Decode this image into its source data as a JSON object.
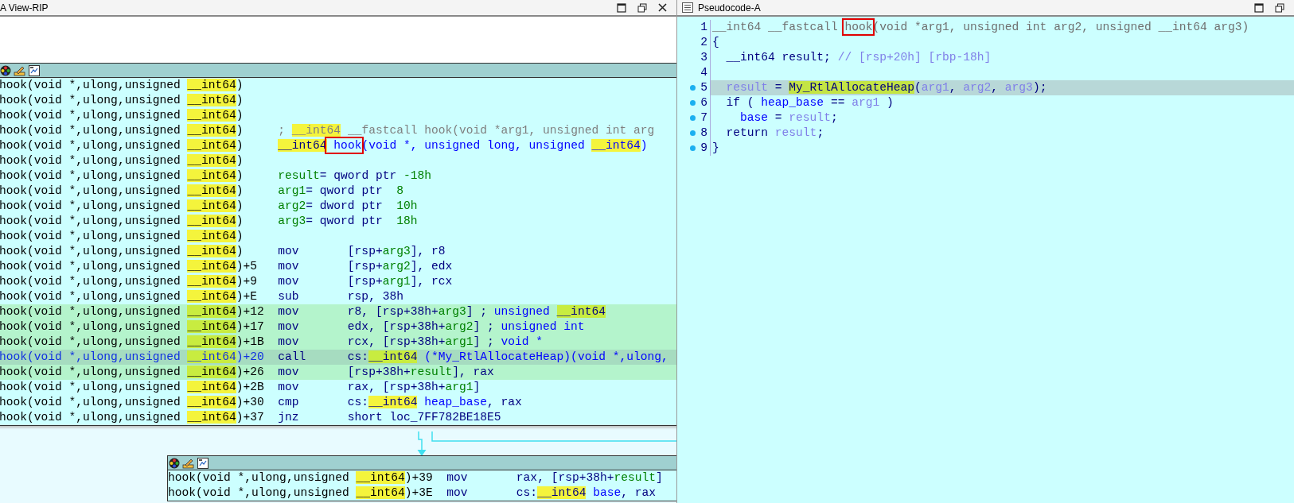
{
  "disassembly": {
    "title": "A View-RIP",
    "node": {
      "rows": [
        {
          "traced": false,
          "selected": false,
          "location": [
            {
              "text": "hook(void *,ulong,unsigned "
            },
            {
              "text": "__int64",
              "kind": "type"
            },
            {
              "text": ")"
            }
          ]
        },
        {
          "traced": false,
          "selected": false,
          "location": [
            {
              "text": "hook(void *,ulong,unsigned "
            },
            {
              "text": "__int64",
              "kind": "type"
            },
            {
              "text": ")"
            }
          ]
        },
        {
          "traced": false,
          "selected": false,
          "location": [
            {
              "text": "hook(void *,ulong,unsigned "
            },
            {
              "text": "__int64",
              "kind": "type"
            },
            {
              "text": ")"
            }
          ]
        },
        {
          "traced": false,
          "selected": false,
          "location": [
            {
              "text": "hook(void *,ulong,unsigned "
            },
            {
              "text": "__int64",
              "kind": "type"
            },
            {
              "text": ")"
            }
          ],
          "operands": [
            {
              "text": "; ",
              "kind": "comment"
            },
            {
              "text": "__int64",
              "kind": "type-comment"
            },
            {
              "text": " __fastcall hook(void *arg1, unsigned int arg",
              "kind": "comment"
            }
          ]
        },
        {
          "traced": false,
          "selected": false,
          "location": [
            {
              "text": "hook(void *,ulong,unsigned "
            },
            {
              "text": "__int64",
              "kind": "type"
            },
            {
              "text": ")"
            }
          ],
          "operands": [
            {
              "text": "__int64",
              "kind": "type"
            },
            {
              "text": " hook",
              "kind": "name",
              "marked": true
            },
            {
              "text": "(void *, unsigned long, unsigned ",
              "kind": "name"
            },
            {
              "text": "__int64",
              "kind": "type-name"
            },
            {
              "text": ")",
              "kind": "name"
            }
          ]
        },
        {
          "traced": false,
          "selected": false,
          "location": [
            {
              "text": "hook(void *,ulong,unsigned "
            },
            {
              "text": "__int64",
              "kind": "type"
            },
            {
              "text": ")"
            }
          ]
        },
        {
          "traced": false,
          "selected": false,
          "location": [
            {
              "text": "hook(void *,ulong,unsigned "
            },
            {
              "text": "__int64",
              "kind": "type"
            },
            {
              "text": ")"
            }
          ],
          "operands": [
            {
              "text": "result",
              "kind": "var"
            },
            {
              "text": "= qword ptr "
            },
            {
              "text": "-18h",
              "kind": "var"
            }
          ]
        },
        {
          "traced": false,
          "selected": false,
          "location": [
            {
              "text": "hook(void *,ulong,unsigned "
            },
            {
              "text": "__int64",
              "kind": "type"
            },
            {
              "text": ")"
            }
          ],
          "operands": [
            {
              "text": "arg1",
              "kind": "var"
            },
            {
              "text": "= qword ptr  "
            },
            {
              "text": "8",
              "kind": "var"
            }
          ]
        },
        {
          "traced": false,
          "selected": false,
          "location": [
            {
              "text": "hook(void *,ulong,unsigned "
            },
            {
              "text": "__int64",
              "kind": "type"
            },
            {
              "text": ")"
            }
          ],
          "operands": [
            {
              "text": "arg2",
              "kind": "var"
            },
            {
              "text": "= dword ptr  "
            },
            {
              "text": "10h",
              "kind": "var"
            }
          ]
        },
        {
          "traced": false,
          "selected": false,
          "location": [
            {
              "text": "hook(void *,ulong,unsigned "
            },
            {
              "text": "__int64",
              "kind": "type"
            },
            {
              "text": ")"
            }
          ],
          "operands": [
            {
              "text": "arg3",
              "kind": "var"
            },
            {
              "text": "= qword ptr  "
            },
            {
              "text": "18h",
              "kind": "var"
            }
          ]
        },
        {
          "traced": false,
          "selected": false,
          "location": [
            {
              "text": "hook(void *,ulong,unsigned "
            },
            {
              "text": "__int64",
              "kind": "type"
            },
            {
              "text": ")"
            }
          ]
        },
        {
          "traced": false,
          "selected": false,
          "location": [
            {
              "text": "hook(void *,ulong,unsigned "
            },
            {
              "text": "__int64",
              "kind": "type"
            },
            {
              "text": ")"
            }
          ],
          "mnemonic": "mov",
          "operands": [
            {
              "text": "[rsp+"
            },
            {
              "text": "arg3",
              "kind": "var"
            },
            {
              "text": "], r8"
            }
          ]
        },
        {
          "traced": false,
          "selected": false,
          "location": [
            {
              "text": "hook(void *,ulong,unsigned "
            },
            {
              "text": "__int64",
              "kind": "type"
            },
            {
              "text": ")+5"
            }
          ],
          "mnemonic": "mov",
          "operands": [
            {
              "text": "[rsp+"
            },
            {
              "text": "arg2",
              "kind": "var"
            },
            {
              "text": "], edx"
            }
          ]
        },
        {
          "traced": false,
          "selected": false,
          "location": [
            {
              "text": "hook(void *,ulong,unsigned "
            },
            {
              "text": "__int64",
              "kind": "type"
            },
            {
              "text": ")+9"
            }
          ],
          "mnemonic": "mov",
          "operands": [
            {
              "text": "[rsp+"
            },
            {
              "text": "arg1",
              "kind": "var"
            },
            {
              "text": "], rcx"
            }
          ]
        },
        {
          "traced": false,
          "selected": false,
          "location": [
            {
              "text": "hook(void *,ulong,unsigned "
            },
            {
              "text": "__int64",
              "kind": "type"
            },
            {
              "text": ")+E"
            }
          ],
          "mnemonic": "sub",
          "operands": [
            {
              "text": "rsp, 38h"
            }
          ]
        },
        {
          "traced": true,
          "selected": false,
          "location": [
            {
              "text": "hook(void *,ulong,unsigned "
            },
            {
              "text": "__int64",
              "kind": "type"
            },
            {
              "text": ")+12"
            }
          ],
          "mnemonic": "mov",
          "operands": [
            {
              "text": "r8, [rsp+38h+"
            },
            {
              "text": "arg3",
              "kind": "var"
            },
            {
              "text": "] ; "
            },
            {
              "text": "unsigned ",
              "kind": "name"
            },
            {
              "text": "__int64",
              "kind": "type"
            }
          ]
        },
        {
          "traced": true,
          "selected": false,
          "location": [
            {
              "text": "hook(void *,ulong,unsigned "
            },
            {
              "text": "__int64",
              "kind": "type"
            },
            {
              "text": ")+17"
            }
          ],
          "mnemonic": "mov",
          "operands": [
            {
              "text": "edx, [rsp+38h+"
            },
            {
              "text": "arg2",
              "kind": "var"
            },
            {
              "text": "] ; "
            },
            {
              "text": "unsigned int",
              "kind": "name"
            }
          ]
        },
        {
          "traced": true,
          "selected": false,
          "location": [
            {
              "text": "hook(void *,ulong,unsigned "
            },
            {
              "text": "__int64",
              "kind": "type"
            },
            {
              "text": ")+1B"
            }
          ],
          "mnemonic": "mov",
          "operands": [
            {
              "text": "rcx, [rsp+38h+"
            },
            {
              "text": "arg1",
              "kind": "var"
            },
            {
              "text": "] ; "
            },
            {
              "text": "void *",
              "kind": "name"
            }
          ]
        },
        {
          "traced": true,
          "selected": true,
          "location": [
            {
              "text": "hook(void *,ulong,unsigned "
            },
            {
              "text": "__int64",
              "kind": "type"
            },
            {
              "text": ")+20"
            }
          ],
          "mnemonic": "call",
          "operands": [
            {
              "text": "cs:"
            },
            {
              "text": "__int64",
              "kind": "type"
            },
            {
              "text": " (*My_RtlAllocateHeap)(void *,ulong,",
              "kind": "name"
            }
          ]
        },
        {
          "traced": true,
          "selected": false,
          "location": [
            {
              "text": "hook(void *,ulong,unsigned "
            },
            {
              "text": "__int64",
              "kind": "type"
            },
            {
              "text": ")+26"
            }
          ],
          "mnemonic": "mov",
          "operands": [
            {
              "text": "[rsp+38h+"
            },
            {
              "text": "result",
              "kind": "var"
            },
            {
              "text": "], rax"
            }
          ]
        },
        {
          "traced": false,
          "selected": false,
          "location": [
            {
              "text": "hook(void *,ulong,unsigned "
            },
            {
              "text": "__int64",
              "kind": "type"
            },
            {
              "text": ")+2B"
            }
          ],
          "mnemonic": "mov",
          "operands": [
            {
              "text": "rax, [rsp+38h+"
            },
            {
              "text": "arg1",
              "kind": "var"
            },
            {
              "text": "]"
            }
          ]
        },
        {
          "traced": false,
          "selected": false,
          "location": [
            {
              "text": "hook(void *,ulong,unsigned "
            },
            {
              "text": "__int64",
              "kind": "type"
            },
            {
              "text": ")+30"
            }
          ],
          "mnemonic": "cmp",
          "operands": [
            {
              "text": "cs:"
            },
            {
              "text": "__int64",
              "kind": "type"
            },
            {
              "text": " heap_base",
              "kind": "name"
            },
            {
              "text": ", rax"
            }
          ]
        },
        {
          "traced": false,
          "selected": false,
          "location": [
            {
              "text": "hook(void *,ulong,unsigned "
            },
            {
              "text": "__int64",
              "kind": "type"
            },
            {
              "text": ")+37"
            }
          ],
          "mnemonic": "jnz",
          "operands": [
            {
              "text": "short loc_7FF782BE18E5"
            }
          ]
        }
      ]
    },
    "next_node": {
      "rows": [
        {
          "traced": false,
          "selected": false,
          "location": [
            {
              "text": "hook(void *,ulong,unsigned "
            },
            {
              "text": "__int64",
              "kind": "type"
            },
            {
              "text": ")+39"
            }
          ],
          "mnemonic": "mov",
          "operands": [
            {
              "text": "rax, [rsp+38h+"
            },
            {
              "text": "result",
              "kind": "var"
            },
            {
              "text": "]"
            }
          ]
        },
        {
          "traced": false,
          "selected": false,
          "location": [
            {
              "text": "hook(void *,ulong,unsigned "
            },
            {
              "text": "__int64",
              "kind": "type"
            },
            {
              "text": ")+3E"
            }
          ],
          "mnemonic": "mov",
          "operands": [
            {
              "text": "cs:"
            },
            {
              "text": "__int64",
              "kind": "type"
            },
            {
              "text": " base",
              "kind": "name"
            },
            {
              "text": ", rax"
            }
          ]
        }
      ]
    }
  },
  "pseudocode": {
    "title": "Pseudocode-A",
    "lines": [
      {
        "number": "1",
        "dot": false,
        "selected": false,
        "code": [
          {
            "text": "__int64 __fastcall ",
            "kind": "faded"
          },
          {
            "text": "hook",
            "kind": "faded",
            "marked": true
          },
          {
            "text": "(void *arg1, unsigned int arg2, unsigned __int64 arg3)",
            "kind": "faded"
          }
        ]
      },
      {
        "number": "2",
        "dot": false,
        "selected": false,
        "code": [
          {
            "text": "{"
          }
        ]
      },
      {
        "number": "3",
        "dot": false,
        "selected": false,
        "code": [
          {
            "text": "  __int64 result; "
          },
          {
            "text": "// [rsp+20h] [rbp-18h]",
            "kind": "local"
          }
        ]
      },
      {
        "number": "4",
        "dot": false,
        "selected": false
      },
      {
        "number": "5",
        "dot": true,
        "selected": true,
        "code": [
          {
            "text": "  result",
            "kind": "local"
          },
          {
            "text": " = "
          },
          {
            "text": "My_RtlAllocateHeap",
            "kind": "hl-name"
          },
          {
            "text": "("
          },
          {
            "text": "arg1",
            "kind": "local"
          },
          {
            "text": ", "
          },
          {
            "text": "arg2",
            "kind": "local"
          },
          {
            "text": ", "
          },
          {
            "text": "arg3",
            "kind": "local"
          },
          {
            "text": ");"
          }
        ]
      },
      {
        "number": "6",
        "dot": true,
        "selected": false,
        "code": [
          {
            "text": "  if ( "
          },
          {
            "text": "heap_base",
            "kind": "name"
          },
          {
            "text": " == "
          },
          {
            "text": "arg1",
            "kind": "local"
          },
          {
            "text": " )"
          }
        ]
      },
      {
        "number": "7",
        "dot": true,
        "selected": false,
        "code": [
          {
            "text": "    base",
            "kind": "name"
          },
          {
            "text": " = "
          },
          {
            "text": "result",
            "kind": "local"
          },
          {
            "text": ";"
          }
        ]
      },
      {
        "number": "8",
        "dot": true,
        "selected": false,
        "code": [
          {
            "text": "  return "
          },
          {
            "text": "result",
            "kind": "local"
          },
          {
            "text": ";"
          }
        ]
      },
      {
        "number": "9",
        "dot": true,
        "selected": false,
        "code": [
          {
            "text": "}"
          }
        ]
      }
    ]
  }
}
